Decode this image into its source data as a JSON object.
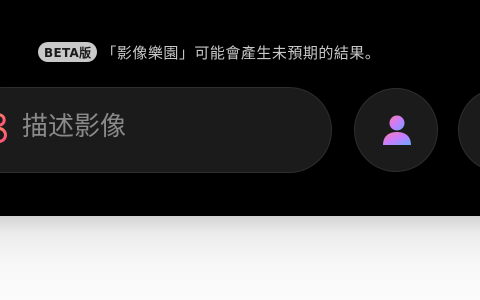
{
  "notice": {
    "badge": "BETA版",
    "text": "「影像樂園」可能會產生未預期的結果。"
  },
  "prompt": {
    "placeholder": "描述影像",
    "value": "",
    "icon": "playground-sparkle-icon"
  },
  "buttons": {
    "avatar_icon": "person-icon",
    "extra": "partially-visible-button"
  },
  "colors": {
    "background": "#000000",
    "field": "#1b1b1b",
    "badge": "#c9c9c9",
    "accent_gradient": [
      "#ff6a88",
      "#c86dff",
      "#5fa8ff"
    ]
  }
}
